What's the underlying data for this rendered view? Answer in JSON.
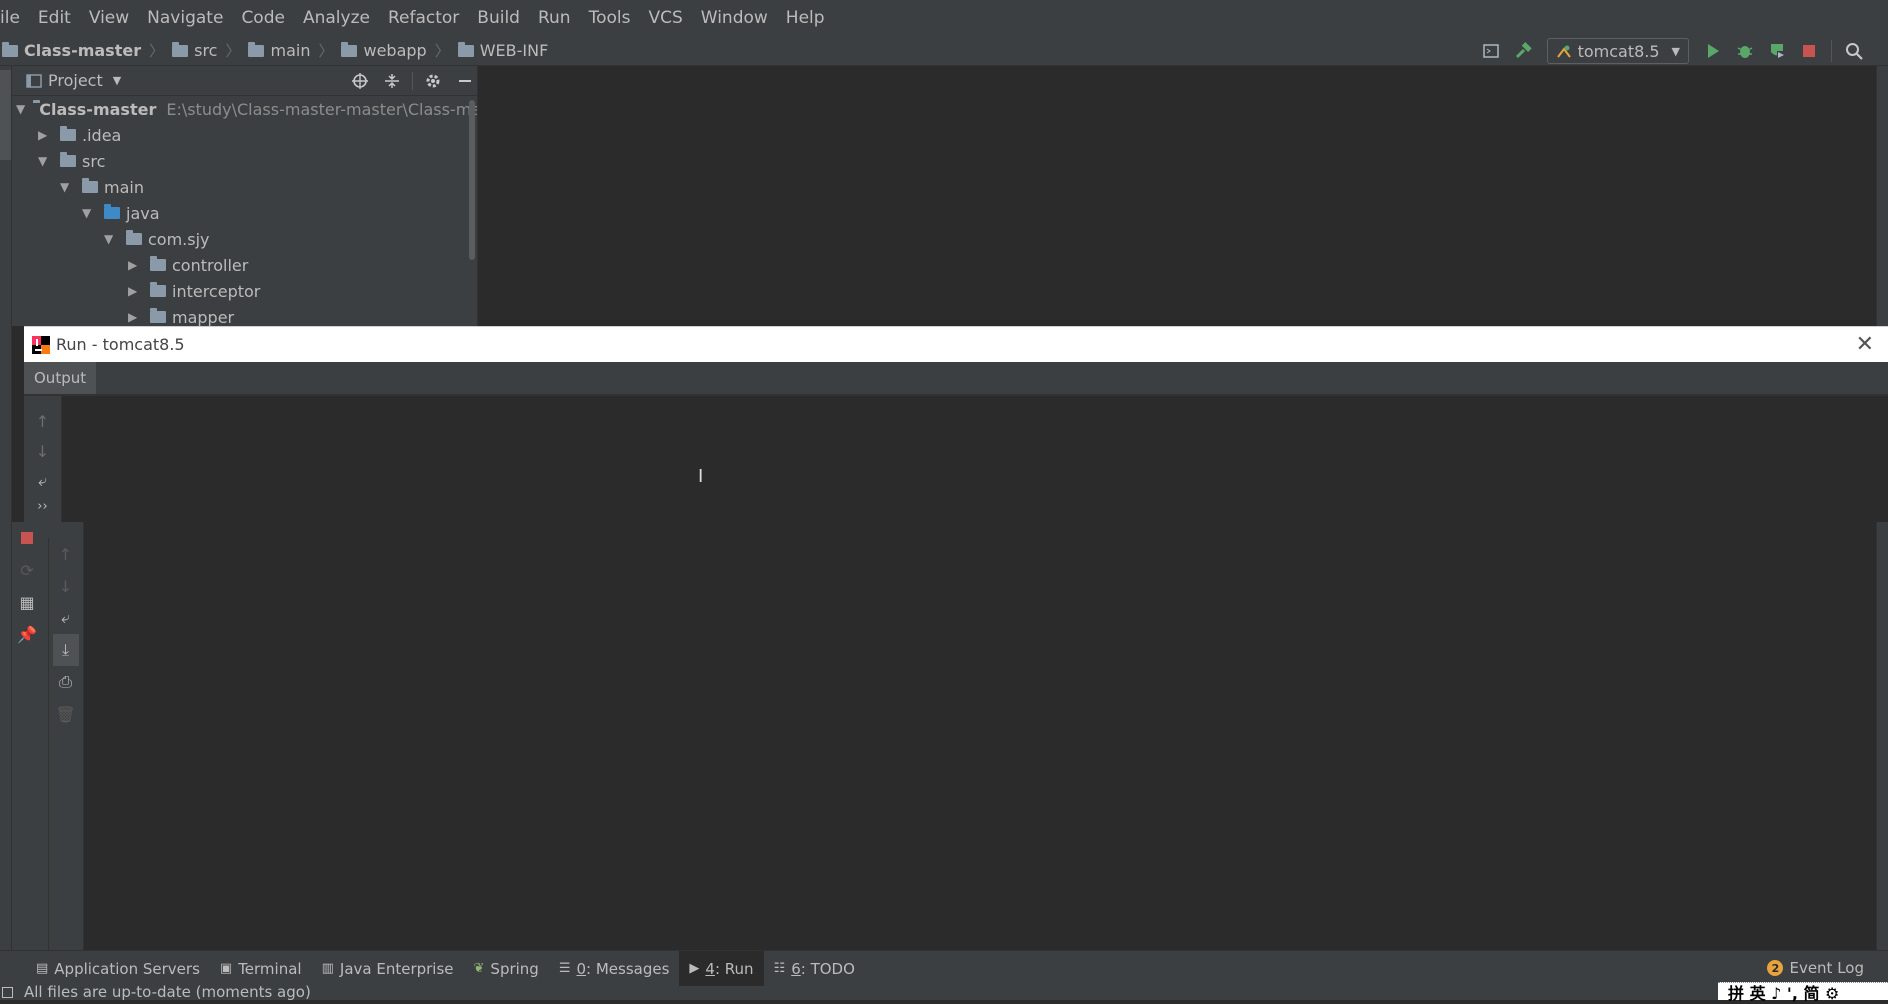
{
  "menu": [
    "ile",
    "Edit",
    "View",
    "Navigate",
    "Code",
    "Analyze",
    "Refactor",
    "Build",
    "Run",
    "Tools",
    "VCS",
    "Window",
    "Help"
  ],
  "breadcrumb": [
    "Class-master",
    "src",
    "main",
    "webapp",
    "WEB-INF"
  ],
  "run_config": "tomcat8.5",
  "project": {
    "title": "Project",
    "root": {
      "name": "Class-master",
      "path": "E:\\study\\Class-master-master\\Class-master"
    },
    "items": [
      ".idea",
      "src",
      "main",
      "java",
      "com.sjy",
      "controller",
      "interceptor",
      "mapper"
    ]
  },
  "run_window": {
    "title": "Run - tomcat8.5",
    "tab": "Output"
  },
  "bottom_tabs": [
    {
      "num": "",
      "label": "Application Servers"
    },
    {
      "num": "",
      "label": "Terminal"
    },
    {
      "num": "",
      "label": "Java Enterprise"
    },
    {
      "num": "",
      "label": "Spring"
    },
    {
      "num": "0",
      "label": ": Messages"
    },
    {
      "num": "4",
      "label": ": Run"
    },
    {
      "num": "6",
      "label": ": TODO"
    }
  ],
  "event_log": {
    "count": "2",
    "label": "Event Log"
  },
  "status": "All files are up-to-date (moments ago)",
  "ime": "拼 英 ♪ ', 简 ⚙",
  "colors": {
    "bg": "#2b2b2b",
    "panel": "#3c3f41",
    "run_green": "#59a869",
    "stop_red": "#c75450"
  }
}
